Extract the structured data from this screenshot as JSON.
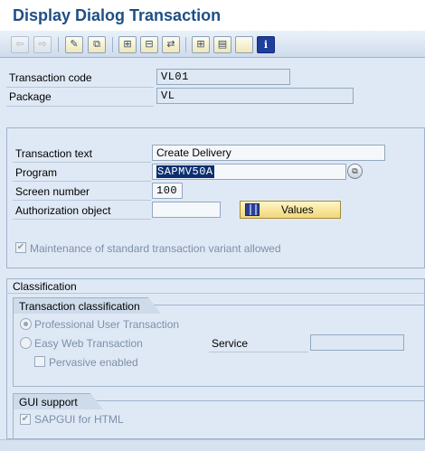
{
  "window": {
    "title": "Display Dialog Transaction"
  },
  "toolbar": {
    "buttons": [
      {
        "name": "back-arrow-icon",
        "glyph": "⇦"
      },
      {
        "name": "forward-arrow-icon",
        "glyph": "⇨"
      },
      {
        "name": "display-change-icon",
        "glyph": "✎"
      },
      {
        "name": "other-object-icon",
        "glyph": "⧉"
      },
      {
        "name": "hierarchy-icon",
        "glyph": "⊞"
      },
      {
        "name": "where-used-icon",
        "glyph": "⊟"
      },
      {
        "name": "navigation-icon",
        "glyph": "⇄"
      },
      {
        "name": "tree-icon",
        "glyph": "⊞"
      },
      {
        "name": "print-icon",
        "glyph": "▤"
      },
      {
        "name": "blank-icon",
        "glyph": ""
      },
      {
        "name": "info-icon",
        "glyph": "i"
      }
    ]
  },
  "header": {
    "transaction_code_label": "Transaction code",
    "transaction_code_value": "VL01",
    "package_label": "Package",
    "package_value": "VL"
  },
  "details": {
    "transaction_text_label": "Transaction text",
    "transaction_text_value": "Create Delivery",
    "program_label": "Program",
    "program_value": "SAPMV50A",
    "screen_number_label": "Screen number",
    "screen_number_value": "100",
    "auth_object_label": "Authorization object",
    "auth_object_value": "",
    "values_button_label": "Values",
    "maintenance_label": "Maintenance of standard transaction variant allowed",
    "maintenance_checked": "✔"
  },
  "classification": {
    "title": "Classification",
    "transaction_classification_title": "Transaction classification",
    "professional_label": "Professional User Transaction",
    "easy_web_label": "Easy Web Transaction",
    "service_label": "Service",
    "service_value": "",
    "pervasive_label": "Pervasive enabled"
  },
  "gui_support": {
    "title": "GUI support",
    "sapgui_html_label": "SAPGUI for HTML",
    "sapgui_html_checked": "✔"
  }
}
